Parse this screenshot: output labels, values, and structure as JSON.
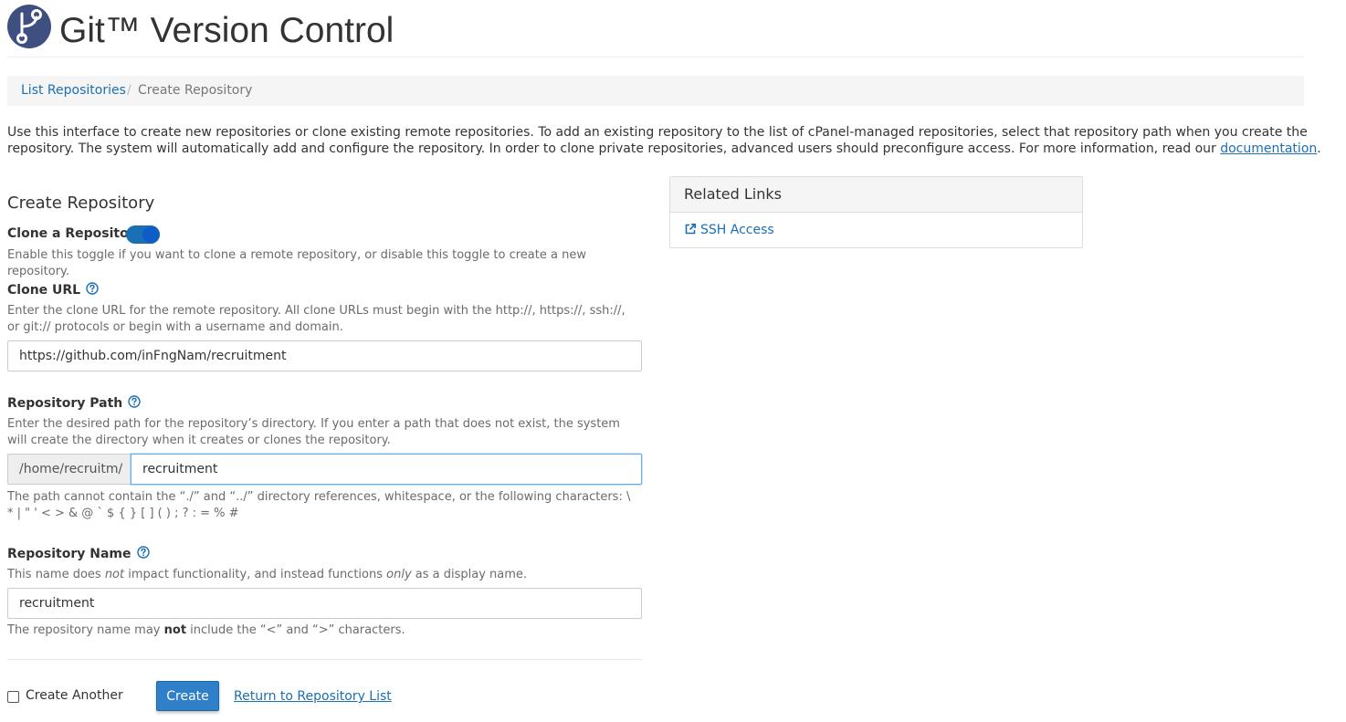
{
  "app": {
    "title": "Git™ Version Control",
    "brand_color": "#3e4f80",
    "logo_icon": "git-branch-icon"
  },
  "breadcrumb": {
    "link": "List Repositories",
    "separator": "/",
    "current": "Create Repository"
  },
  "intro": {
    "text": "Use this interface to create new repositories or clone existing remote repositories. To add an existing repository to the list of cPanel-managed repositories, select that repository path when you create the repository. The system will automatically add and configure the repository. In order to clone private repositories, advanced users should preconfigure access. For more information, read our ",
    "link": "documentation",
    "end": "."
  },
  "form": {
    "title": "Create Repository",
    "clone": {
      "label": "Clone a Repository",
      "enabled": true,
      "hint": "Enable this toggle if you want to clone a remote repository, or disable this toggle to create a new repository."
    },
    "clone_url": {
      "label": "Clone URL",
      "help_icon": "question-circle-icon",
      "hint": "Enter the clone URL for the remote repository. All clone URLs must begin with the http://, https://, ssh://, or git:// protocols or begin with a username and domain.",
      "value": "https://github.com/inFngNam/recruitment"
    },
    "repo_path": {
      "label": "Repository Path",
      "help_icon": "question-circle-icon",
      "hint": "Enter the desired path for the repository’s directory. If you enter a path that does not exist, the system will create the directory when it creates or clones the repository.",
      "prefix": "/home/recruitm/",
      "value": "recruitment",
      "note": "The path cannot contain the “./” and “../” directory references, whitespace, or the following characters: \\ * | \" ' < > & @ ` $ { } [ ] ( ) ; ? : = % #"
    },
    "repo_name": {
      "label": "Repository Name",
      "help_icon": "question-circle-icon",
      "hint_part1": "This name does ",
      "hint_em1": "not",
      "hint_part2": " impact functionality, and instead functions ",
      "hint_em2": "only",
      "hint_part3": " as a display name.",
      "value": "recruitment",
      "note_part1": "The repository name may ",
      "note_strong": "not",
      "note_part2": " include the “<” and “>” characters."
    },
    "create_another": {
      "label": "Create Another",
      "checked": false
    },
    "create_button": "Create",
    "return_link": "Return to Repository List"
  },
  "related_links": {
    "title": "Related Links",
    "items": [
      {
        "label": "SSH Access",
        "icon": "external-link-icon"
      }
    ]
  }
}
